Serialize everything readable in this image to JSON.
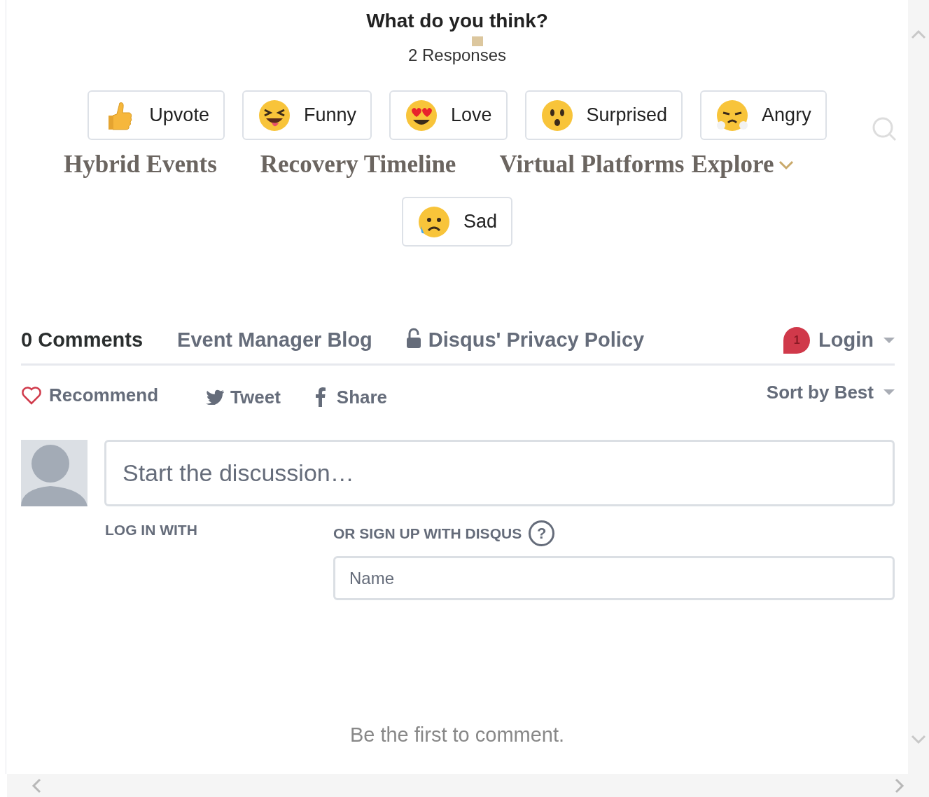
{
  "poll": {
    "title": "What do you think?",
    "responses": "2 Responses",
    "reactions": [
      {
        "kind": "thumbs",
        "label": "Upvote"
      },
      {
        "kind": "funny",
        "label": "Funny"
      },
      {
        "kind": "love",
        "label": "Love"
      },
      {
        "kind": "surprised",
        "label": "Surprised"
      },
      {
        "kind": "angry",
        "label": "Angry"
      },
      {
        "kind": "sad",
        "label": "Sad"
      }
    ]
  },
  "site_nav": {
    "items": [
      "Hybrid Events",
      "Recovery Timeline",
      "Virtual Platforms",
      "Explore"
    ]
  },
  "comments": {
    "count_label": "0 Comments",
    "community": "Event Manager Blog",
    "privacy": "Disqus' Privacy Policy",
    "login": "Login",
    "notifications": "1",
    "recommend": "Recommend",
    "tweet": "Tweet",
    "share": "Share",
    "sort": "Sort by Best",
    "composer": {
      "placeholder": "Start the discussion…"
    },
    "login_with": "LOG IN WITH",
    "signup": "OR SIGN UP WITH DISQUS",
    "help": "?",
    "name_field": {
      "placeholder": "Name"
    },
    "empty": "Be the first to comment."
  }
}
